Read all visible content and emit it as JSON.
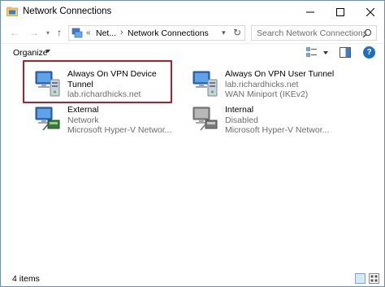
{
  "window": {
    "title": "Network Connections",
    "controls": {
      "minimize": "—",
      "maximize": "☐",
      "close": "✕"
    }
  },
  "address": {
    "back": "←",
    "forward": "→",
    "up": "↑",
    "overflow": "«",
    "segment1": "Net...",
    "separator": "›",
    "segment2": "Network Connections",
    "refresh": "↻"
  },
  "search": {
    "placeholder": "Search Network Connections"
  },
  "toolbar": {
    "organize_label": "Organize"
  },
  "connections": [
    {
      "name": "Always On VPN Device",
      "name2": "Tunnel",
      "line2": "lab.richardhicks.net",
      "line3": "",
      "status": "connected",
      "highlighted": true
    },
    {
      "name": "Always On VPN User Tunnel",
      "name2": "",
      "line2": "lab.richardhicks.net",
      "line3": "WAN Miniport (IKEv2)",
      "status": "connected",
      "highlighted": false
    },
    {
      "name": "External",
      "name2": "",
      "line2": "Network",
      "line3": "Microsoft Hyper-V Networ...",
      "status": "connected",
      "highlighted": false
    },
    {
      "name": "Internal",
      "name2": "",
      "line2": "Disabled",
      "line3": "Microsoft Hyper-V Networ...",
      "status": "disabled",
      "highlighted": false
    }
  ],
  "status": {
    "items_count": "4 items"
  },
  "colors": {
    "highlight_border": "#a8212f",
    "accent": "#1a6fc9"
  }
}
